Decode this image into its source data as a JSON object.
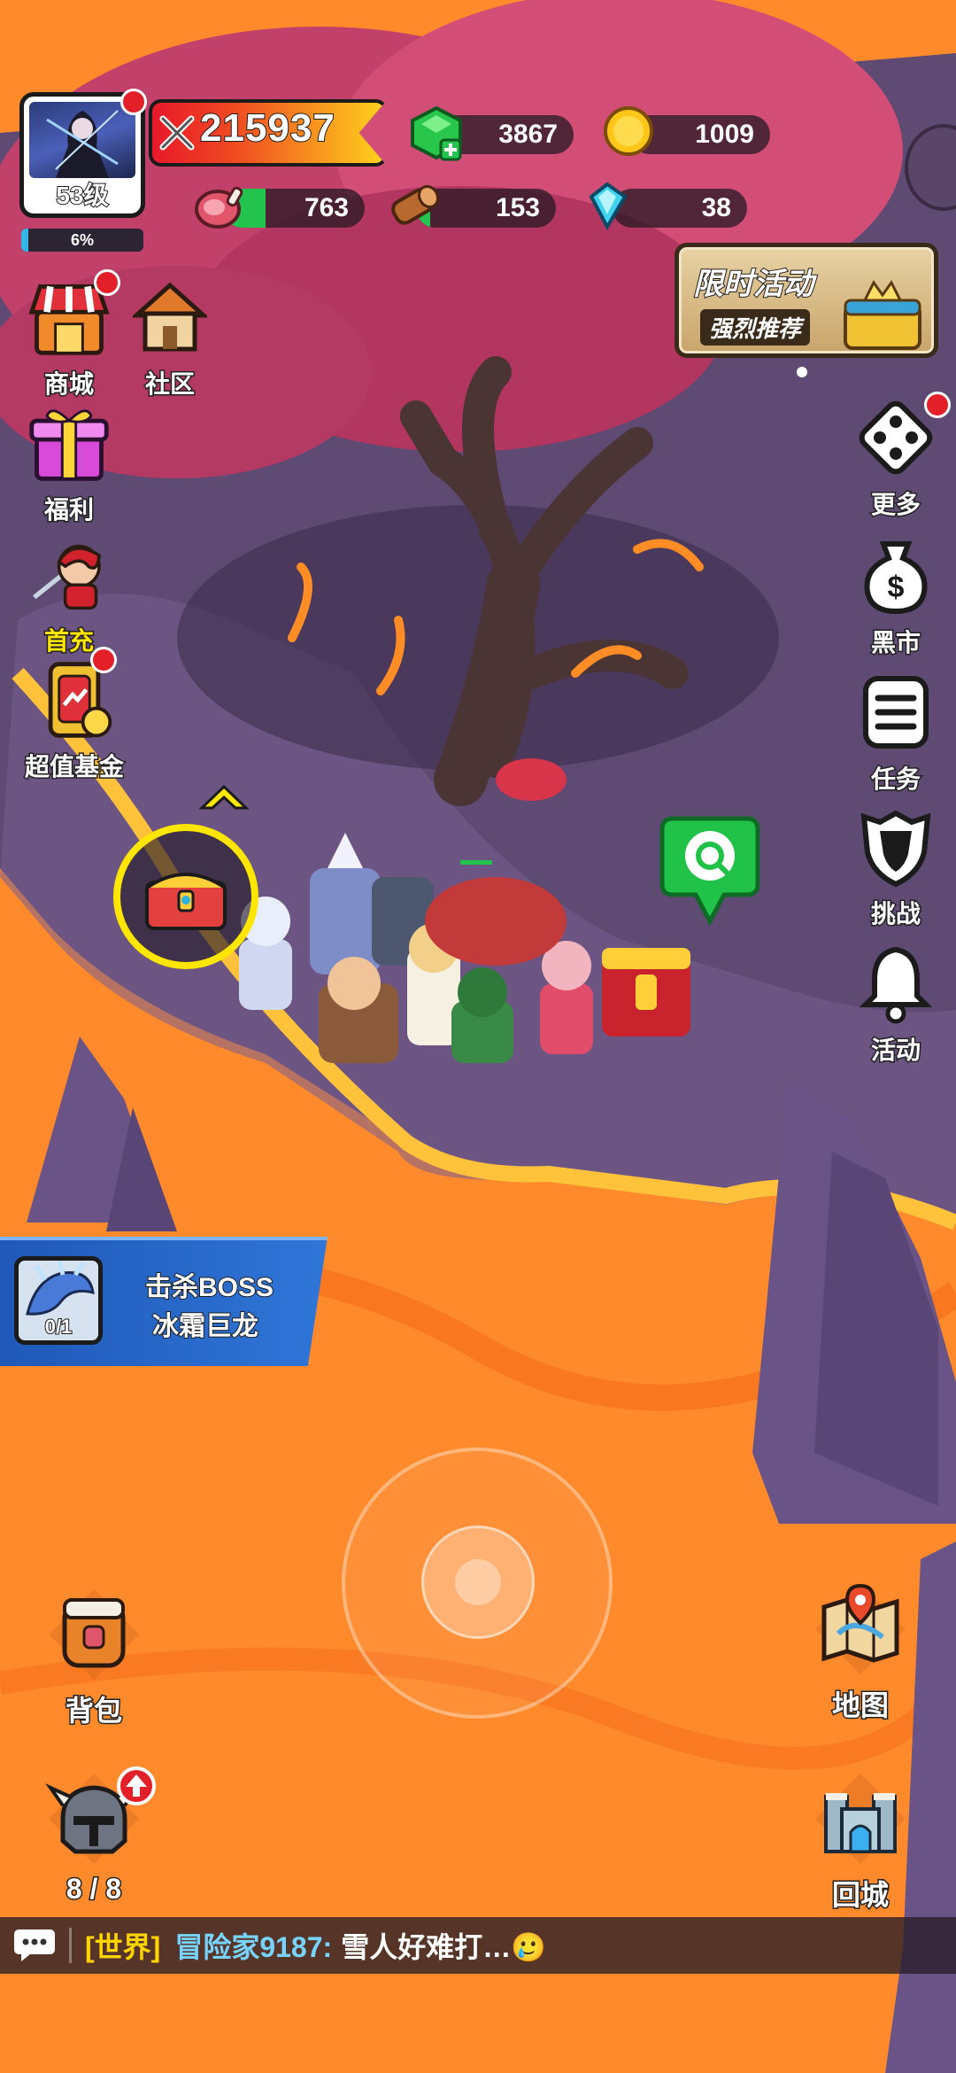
{
  "player": {
    "level": "53级",
    "exp_percent_text": "6%",
    "exp_fraction": 0.06,
    "power": "215937"
  },
  "resources": {
    "gems": "3867",
    "gold": "1009",
    "meat": "763",
    "meat_fill": 0.3,
    "wood": "153",
    "wood_fill": 0.1,
    "crystal": "38"
  },
  "event_banner": {
    "title": "限时活动",
    "subtitle": "强烈推荐"
  },
  "left_menu": [
    {
      "label": "商城",
      "icon": "shop-icon"
    },
    {
      "label": "社区",
      "icon": "community-icon"
    },
    {
      "label": "福利",
      "icon": "gift-icon"
    },
    {
      "label": "首充",
      "icon": "first-recharge-icon"
    },
    {
      "label": "超值基金",
      "icon": "fund-icon"
    }
  ],
  "right_menu": [
    {
      "label": "更多",
      "icon": "more-icon"
    },
    {
      "label": "黑市",
      "icon": "money-bag-icon"
    },
    {
      "label": "任务",
      "icon": "task-list-icon"
    },
    {
      "label": "挑战",
      "icon": "shield-icon"
    },
    {
      "label": "活动",
      "icon": "bell-icon"
    }
  ],
  "quest": {
    "progress": "0/1",
    "title": "击杀BOSS",
    "target": "冰霜巨龙"
  },
  "bottom": {
    "bag_label": "背包",
    "map_label": "地图",
    "heroes_count": "8 / 8",
    "return_label": "回城"
  },
  "chat": {
    "channel": "[世界]",
    "sender": "冒险家9187:",
    "message": "雪人好难打…🥲"
  },
  "colors": {
    "lava": "#ff8a2c",
    "ground": "#5f4a74",
    "tree_canopy": "#c2416a",
    "accent_yellow": "#ffd400",
    "green": "#22c44d",
    "red_badge": "#e3202a"
  }
}
